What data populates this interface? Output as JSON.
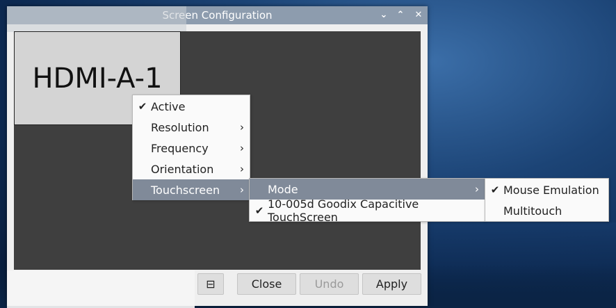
{
  "window": {
    "title": "Screen Configuration",
    "minimize_glyph": "⌄",
    "maximize_glyph": "⌃",
    "close_glyph": "✕"
  },
  "monitor": {
    "name": "HDMI-A-1"
  },
  "buttons": {
    "close": "Close",
    "undo": "Undo",
    "apply": "Apply",
    "small_icon": "⊟"
  },
  "menu": {
    "items": [
      {
        "label": "Active",
        "checked": true,
        "submenu": false
      },
      {
        "label": "Resolution",
        "checked": false,
        "submenu": true
      },
      {
        "label": "Frequency",
        "checked": false,
        "submenu": true
      },
      {
        "label": "Orientation",
        "checked": false,
        "submenu": true
      },
      {
        "label": "Touchscreen",
        "checked": false,
        "submenu": true,
        "selected": true
      }
    ]
  },
  "touch_menu": {
    "items": [
      {
        "label": "Mode",
        "submenu": true,
        "selected": true
      },
      {
        "label": "10-005d Goodix Capacitive TouchScreen",
        "checked": true
      }
    ]
  },
  "mode_menu": {
    "items": [
      {
        "label": "Mouse Emulation",
        "checked": true
      },
      {
        "label": "Multitouch",
        "checked": false
      }
    ]
  },
  "glyphs": {
    "check": "✔",
    "arrow": "›"
  },
  "colors": {
    "titlebar": "#8d9cae",
    "selected": "#808a99",
    "canvas": "#3f3f3f"
  }
}
